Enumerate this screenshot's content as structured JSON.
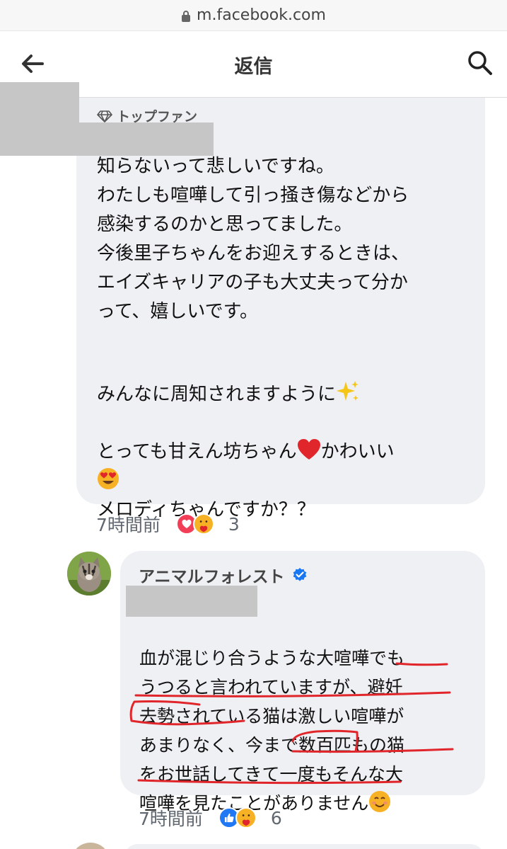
{
  "browser": {
    "url": "m.facebook.com"
  },
  "header": {
    "title": "返信"
  },
  "comment1": {
    "badge": "トップファン",
    "paragraph1": "知らないって悲しいですね。\nわたしも喧嘩して引っ掻き傷などから\n感染するのかと思ってました。\n今後里子ちゃんをお迎えするときは、\nエイズキャリアの子も大丈夫って分か\nって、嬉しいです。",
    "paragraph2": "みんなに周知されますように",
    "paragraph3_part1": "とっても甘えん坊ちゃん",
    "paragraph3_part2": "かわいい",
    "paragraph3_part3": "メロディちゃんですか？？",
    "time": "7時間前",
    "reaction_count": "3",
    "reactions": [
      "love",
      "care"
    ]
  },
  "reply1": {
    "page_name": "アニマルフォレスト",
    "verified": true,
    "text": "血が混じり合うような大喧嘩でも\nうつると言われていますが、避妊\n去勢されている猫は激しい喧嘩が\nあまりなく、今まで数百匹もの猫\nをお世話してきて一度もそんな大\n喧嘩を見たことがありません",
    "time": "7時間前",
    "reaction_count": "6",
    "reactions": [
      "like",
      "care"
    ]
  },
  "colors": {
    "bubble": "#eff0f3",
    "annotation_red": "#e0262b",
    "verified_blue": "#1877f2",
    "meta_gray": "#606770"
  }
}
